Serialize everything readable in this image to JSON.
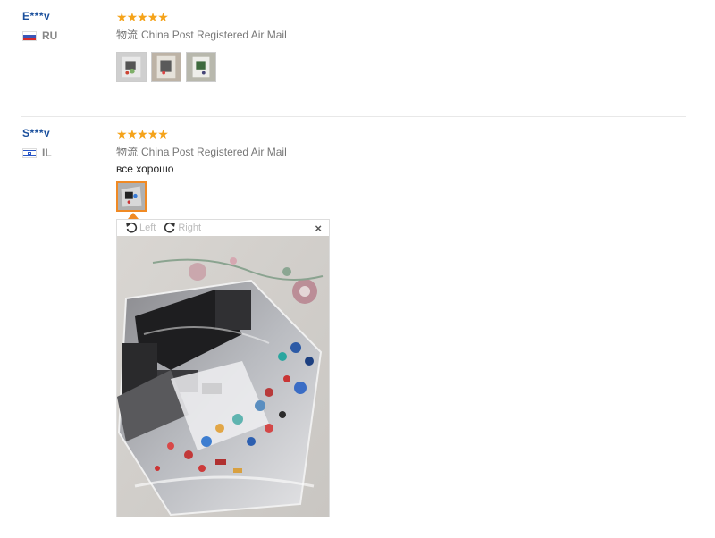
{
  "reviews": [
    {
      "user": "E***v",
      "country_code": "RU",
      "rating": 5,
      "shipping_label": "物流",
      "shipping_method": "China Post Registered Air Mail",
      "text": "",
      "thumbnails": [
        "photo-1",
        "photo-2",
        "photo-3"
      ]
    },
    {
      "user": "S***v",
      "country_code": "IL",
      "rating": 5,
      "shipping_label": "物流",
      "shipping_method": "China Post Registered Air Mail",
      "text": "все хорошо",
      "thumbnails": [
        "photo-1"
      ]
    }
  ],
  "viewer": {
    "rotate_left_label": "Left",
    "rotate_right_label": "Right",
    "close_label": "×"
  },
  "colors": {
    "username": "#1a4f9c",
    "star": "#f5a31a",
    "active_thumb_border": "#f08a24"
  }
}
